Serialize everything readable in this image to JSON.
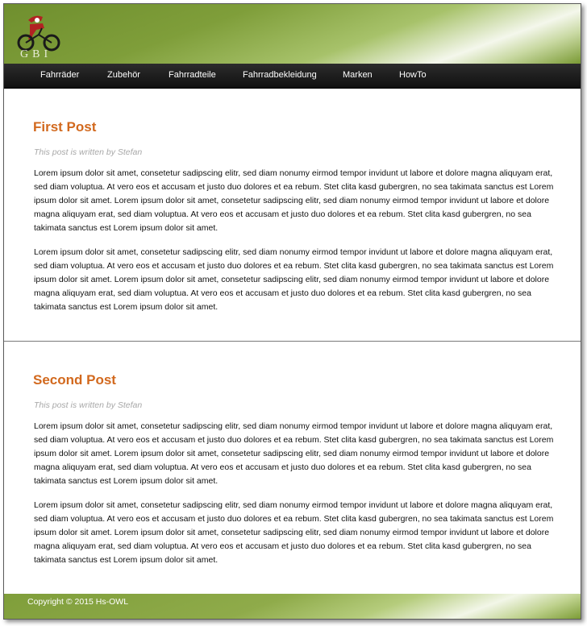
{
  "brand": {
    "logo_text": "GBI",
    "colors": {
      "accent": "#d2691e",
      "header_green": "#7f9e3a",
      "nav_bg": "#1c1c1c",
      "logo_red": "#b22222"
    }
  },
  "nav": {
    "items": [
      {
        "label": "Fahrräder"
      },
      {
        "label": "Zubehör"
      },
      {
        "label": "Fahrradteile"
      },
      {
        "label": "Fahrradbekleidung"
      },
      {
        "label": "Marken"
      },
      {
        "label": "HowTo"
      }
    ]
  },
  "posts": [
    {
      "title": "First Post",
      "meta": "This post is written by Stefan",
      "paragraphs": [
        "Lorem ipsum dolor sit amet, consetetur sadipscing elitr, sed diam nonumy eirmod tempor invidunt ut labore et dolore magna aliquyam erat, sed diam voluptua. At vero eos et accusam et justo duo dolores et ea rebum. Stet clita kasd gubergren, no sea takimata sanctus est Lorem ipsum dolor sit amet. Lorem ipsum dolor sit amet, consetetur sadipscing elitr, sed diam nonumy eirmod tempor invidunt ut labore et dolore magna aliquyam erat, sed diam voluptua. At vero eos et accusam et justo duo dolores et ea rebum. Stet clita kasd gubergren, no sea takimata sanctus est Lorem ipsum dolor sit amet.",
        "Lorem ipsum dolor sit amet, consetetur sadipscing elitr, sed diam nonumy eirmod tempor invidunt ut labore et dolore magna aliquyam erat, sed diam voluptua. At vero eos et accusam et justo duo dolores et ea rebum. Stet clita kasd gubergren, no sea takimata sanctus est Lorem ipsum dolor sit amet. Lorem ipsum dolor sit amet, consetetur sadipscing elitr, sed diam nonumy eirmod tempor invidunt ut labore et dolore magna aliquyam erat, sed diam voluptua. At vero eos et accusam et justo duo dolores et ea rebum. Stet clita kasd gubergren, no sea takimata sanctus est Lorem ipsum dolor sit amet."
      ]
    },
    {
      "title": "Second Post",
      "meta": "This post is written by Stefan",
      "paragraphs": [
        "Lorem ipsum dolor sit amet, consetetur sadipscing elitr, sed diam nonumy eirmod tempor invidunt ut labore et dolore magna aliquyam erat, sed diam voluptua. At vero eos et accusam et justo duo dolores et ea rebum. Stet clita kasd gubergren, no sea takimata sanctus est Lorem ipsum dolor sit amet. Lorem ipsum dolor sit amet, consetetur sadipscing elitr, sed diam nonumy eirmod tempor invidunt ut labore et dolore magna aliquyam erat, sed diam voluptua. At vero eos et accusam et justo duo dolores et ea rebum. Stet clita kasd gubergren, no sea takimata sanctus est Lorem ipsum dolor sit amet.",
        "Lorem ipsum dolor sit amet, consetetur sadipscing elitr, sed diam nonumy eirmod tempor invidunt ut labore et dolore magna aliquyam erat, sed diam voluptua. At vero eos et accusam et justo duo dolores et ea rebum. Stet clita kasd gubergren, no sea takimata sanctus est Lorem ipsum dolor sit amet. Lorem ipsum dolor sit amet, consetetur sadipscing elitr, sed diam nonumy eirmod tempor invidunt ut labore et dolore magna aliquyam erat, sed diam voluptua. At vero eos et accusam et justo duo dolores et ea rebum. Stet clita kasd gubergren, no sea takimata sanctus est Lorem ipsum dolor sit amet."
      ]
    }
  ],
  "footer": {
    "copyright": "Copyright © 2015 Hs-OWL"
  }
}
